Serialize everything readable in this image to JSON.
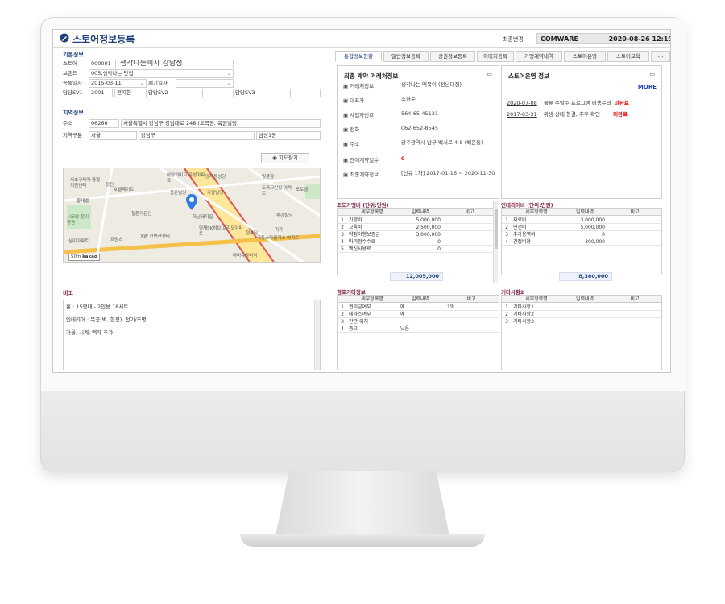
{
  "header": {
    "title": "스토어정보등록",
    "last_change_label": "최종변경",
    "last_change_user": "COMWARE",
    "last_change_time": "2020-08-26 12:19"
  },
  "basic": {
    "section_title": "기본정보",
    "store_label": "스토어",
    "store_code": "000001",
    "store_name": "생각나는피자 강남점",
    "brand_label": "브랜드",
    "brand_value": "005,생각나는 맛집",
    "reg_date_label": "등록일자",
    "reg_date_value": "2015-03-11",
    "close_date_label": "폐기일자",
    "sv1_label": "담당SV1",
    "sv1_code": "2001",
    "sv1_name": "전지현",
    "sv2_label": "담당SV2",
    "sv3_label": "담당SV3"
  },
  "region": {
    "section_title": "지역정보",
    "addr_label": "주소",
    "zip": "06266",
    "address": "서울특별시 강남구 강남대로 248 (도곡동, 목원빌딩)",
    "area_label": "지역구분",
    "area1": "서울",
    "area2": "강남구",
    "area3": "삼성1동",
    "map_button": "지도찾기",
    "map_labels": [
      "서초구육아 종합지원센터",
      "정진",
      "호텔페이트",
      "야당의비교 우성아파트",
      "양재동성당",
      "일품향",
      "용문빌딩",
      "가람빌딩",
      "도곡그린빌 아파트",
      "포토엠",
      "황재벨",
      "힐튼가든인",
      "하남돼지집",
      "부강빌딩",
      "시모랑 천이공원",
      "양재SK허브 프리모아파트",
      "현부닥",
      "미각",
      "극동스타클래스 아파트",
      "삼미아파트",
      "프림츠",
      "KW 컨벤션센터",
      "라미슈클리닉"
    ],
    "map_scale": "50m",
    "map_brand": "kakao"
  },
  "memo": {
    "section_title": "비고",
    "lines": [
      "홀 : 15평대 - 2인용 18세트",
      "인테리어 : 목공(벽, 현정), 전기/조명",
      "거울, 시계, 액자 추가"
    ]
  },
  "tabs": [
    "통합정보현황",
    "일반정보등록",
    "상권정보등록",
    "이미지등록",
    "가맹계약내역",
    "스토어운영",
    "스토어교육"
  ],
  "contract": {
    "title": "최종 계약 거래처정보",
    "rows": [
      {
        "k": "거래처정보",
        "v": "생각나는 떡볶이 (전남대점)"
      },
      {
        "k": "대표자",
        "v": "조향수"
      },
      {
        "k": "사업자번호",
        "v": "564-65-45131"
      },
      {
        "k": "전화",
        "v": "062-652-8545"
      },
      {
        "k": "주소",
        "v": "광주광역시 남구 백서로 4-8 (백운동)"
      },
      {
        "k": "잔여계약일수",
        "v": "0"
      },
      {
        "k": "최종계약정보",
        "v": "[신규 1차] 2017-01-16 ~ 2020-11-30"
      }
    ]
  },
  "ops": {
    "title": "스토어운영 정보",
    "more": "MORE",
    "items": [
      {
        "date": "2020-07-08",
        "text": "물류 수발주 프로그램 비용문의",
        "status": "미완료"
      },
      {
        "date": "2017-03-31",
        "text": "위생 상태 청결, 추후 확인",
        "status": "미완료"
      }
    ]
  },
  "initial_cost": {
    "title": "초도가맹비 (단위:만원)",
    "headers": [
      "세부항목명",
      "입력내역",
      "비고"
    ],
    "rows": [
      {
        "n": "1",
        "name": "가맹비",
        "val": "5,000,000",
        "note": ""
      },
      {
        "n": "2",
        "name": "교육비",
        "val": "2,500,000",
        "note": ""
      },
      {
        "n": "3",
        "name": "약정이행보증금",
        "val": "3,000,000",
        "note": ""
      },
      {
        "n": "4",
        "name": "마리점수수료",
        "val": "0",
        "note": ""
      },
      {
        "n": "5",
        "name": "백신사용료",
        "val": "0",
        "note": ""
      }
    ],
    "total": "12,005,000"
  },
  "interior_cost": {
    "title": "인테리어비 (단위:만원)",
    "headers": [
      "세부항목명",
      "입력내역",
      "비고"
    ],
    "rows": [
      {
        "n": "1",
        "name": "재료비",
        "val": "3,000,000",
        "note": ""
      },
      {
        "n": "2",
        "name": "인건비",
        "val": "5,000,000",
        "note": ""
      },
      {
        "n": "3",
        "name": "추가용역비",
        "val": "0",
        "note": ""
      },
      {
        "n": "4",
        "name": "간접비용",
        "val": "300,000",
        "note": ""
      }
    ],
    "total": "8,380,000"
  },
  "store_etc": {
    "title": "점포기타정보",
    "headers": [
      "세부항목명",
      "입력내역",
      "비고"
    ],
    "rows": [
      {
        "n": "1",
        "name": "권리금여부",
        "val": "예",
        "note": "1억"
      },
      {
        "n": "2",
        "name": "테라스여부",
        "val": "예",
        "note": ""
      },
      {
        "n": "3",
        "name": "간판 위치",
        "val": "",
        "note": ""
      },
      {
        "n": "4",
        "name": "층고",
        "val": "낮음",
        "note": ""
      }
    ]
  },
  "etc2": {
    "title": "기타사항2",
    "headers": [
      "세부항목명",
      "입력내역",
      "비고"
    ],
    "rows": [
      {
        "n": "1",
        "name": "기타사항1",
        "val": "",
        "note": ""
      },
      {
        "n": "2",
        "name": "기타사항2",
        "val": "",
        "note": ""
      },
      {
        "n": "3",
        "name": "기타사항3",
        "val": "",
        "note": ""
      }
    ]
  },
  "colors": {
    "accent": "#1d3f7a",
    "alert": "#e00000",
    "pin": "#2d7de0"
  }
}
